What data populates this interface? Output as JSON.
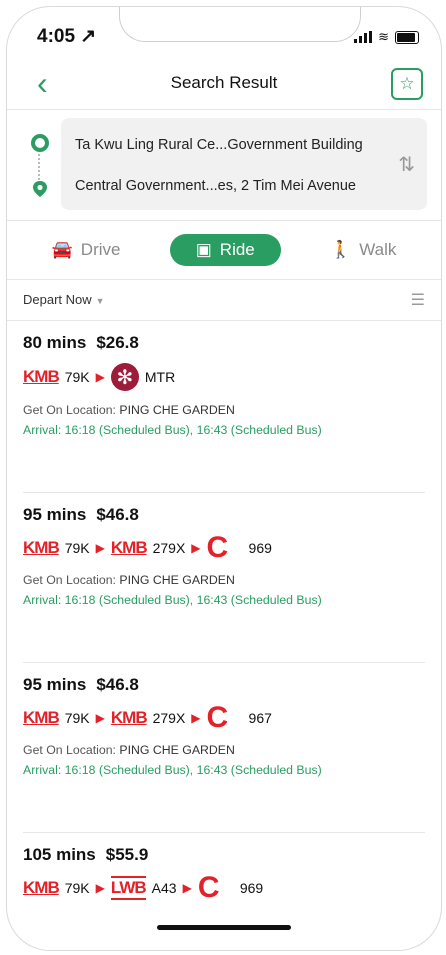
{
  "status": {
    "time": "4:05 ↗"
  },
  "header": {
    "back_icon": "chevron-left-icon",
    "title": "Search Result",
    "favorite_icon": "star-icon"
  },
  "route": {
    "from": "Ta Kwu Ling Rural Ce...Government Building",
    "to": "Central Government...es, 2 Tim Mei Avenue"
  },
  "modes": [
    {
      "label": "Drive",
      "icon": "car-icon"
    },
    {
      "label": "Ride",
      "icon": "bus-icon"
    },
    {
      "label": "Walk",
      "icon": "walk-icon"
    }
  ],
  "filter": {
    "depart": "Depart Now",
    "filter_icon": "sliders-icon"
  },
  "results": [
    {
      "duration": "80 mins",
      "fare": "$26.8",
      "legs": [
        {
          "operator": "KMB",
          "route": "79K"
        },
        {
          "operator": "MTR",
          "route": "MTR"
        }
      ],
      "get_on_label": "Get On Location:",
      "get_on": "PING CHE GARDEN",
      "arrival": "Arrival: 16:18 (Scheduled Bus), 16:43 (Scheduled Bus)"
    },
    {
      "duration": "95 mins",
      "fare": "$46.8",
      "legs": [
        {
          "operator": "KMB",
          "route": "79K"
        },
        {
          "operator": "KMB",
          "route": "279X"
        },
        {
          "operator": "CTB",
          "route": "969"
        }
      ],
      "get_on_label": "Get On Location:",
      "get_on": "PING CHE GARDEN",
      "arrival": "Arrival: 16:18 (Scheduled Bus), 16:43 (Scheduled Bus)"
    },
    {
      "duration": "95 mins",
      "fare": "$46.8",
      "legs": [
        {
          "operator": "KMB",
          "route": "79K"
        },
        {
          "operator": "KMB",
          "route": "279X"
        },
        {
          "operator": "CTB",
          "route": "967"
        }
      ],
      "get_on_label": "Get On Location:",
      "get_on": "PING CHE GARDEN",
      "arrival": "Arrival: 16:18 (Scheduled Bus), 16:43 (Scheduled Bus)"
    },
    {
      "duration": "105 mins",
      "fare": "$55.9",
      "legs": [
        {
          "operator": "KMB",
          "route": "79K"
        },
        {
          "operator": "LWB",
          "route": "A43"
        },
        {
          "operator": "CTB",
          "route": "969"
        }
      ]
    }
  ],
  "colors": {
    "accent": "#2a9d62",
    "operator_red": "#e32128",
    "mtr": "#9c1c3a"
  },
  "logos": {
    "kmb": "KMB",
    "lwb": "LWB"
  }
}
